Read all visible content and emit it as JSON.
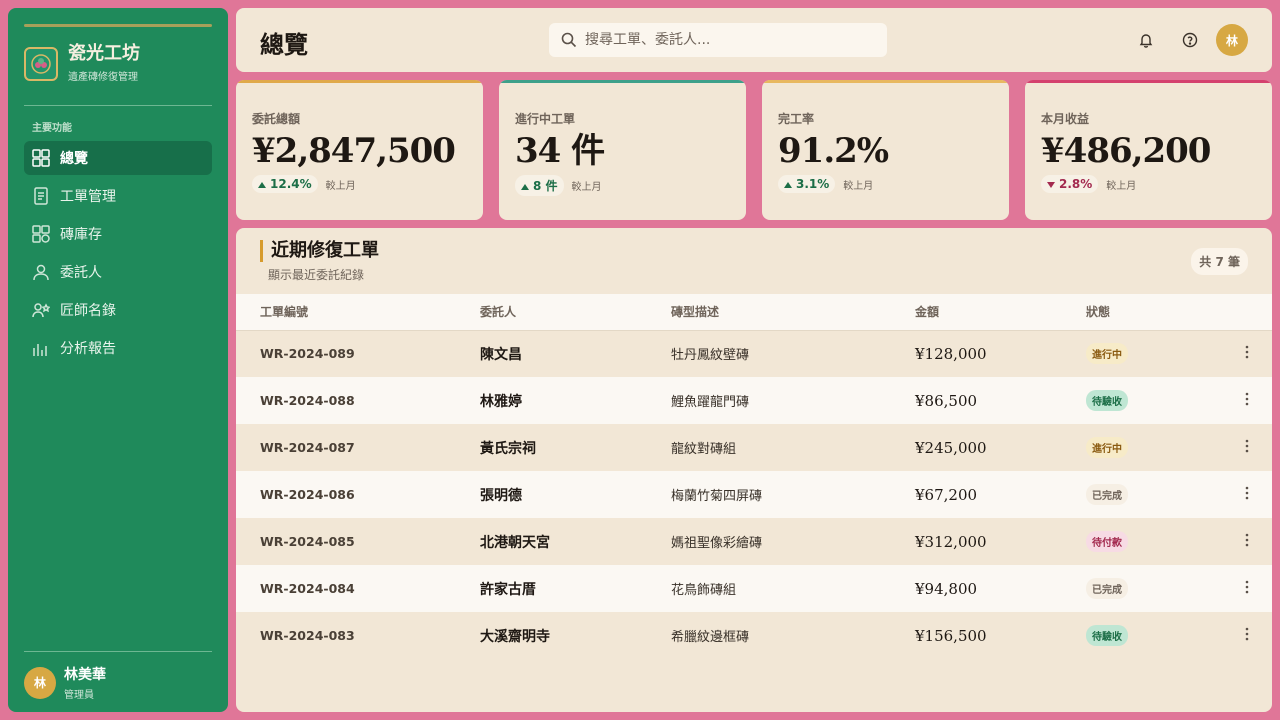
{
  "app": {
    "name": "瓷光工坊",
    "subtitle": "遺產磚修復管理",
    "logo_icon": "tile-flower-icon",
    "accent": "#1f8a5b"
  },
  "sidebar": {
    "section_label": "主要功能",
    "items": [
      {
        "label": "總覽",
        "icon": "grid-icon",
        "active": true
      },
      {
        "label": "工單管理",
        "icon": "document-icon",
        "active": false
      },
      {
        "label": "磚庫存",
        "icon": "tiles-icon",
        "active": false
      },
      {
        "label": "委託人",
        "icon": "user-icon",
        "active": false
      },
      {
        "label": "匠師名錄",
        "icon": "craftsman-icon",
        "active": false
      },
      {
        "label": "分析報告",
        "icon": "bar-chart-icon",
        "active": false
      }
    ],
    "user": {
      "avatar": "林",
      "name": "林美華",
      "role": "管理員"
    }
  },
  "header": {
    "title": "總覽",
    "search_placeholder": "搜尋工單、委託人...",
    "avatar": "林"
  },
  "stats": [
    {
      "label": "委託總額",
      "value": "¥2,847,500",
      "delta": "12.4%",
      "direction": "up",
      "note": "較上月",
      "accent": "#e0a94a"
    },
    {
      "label": "進行中工單",
      "value": "34 件",
      "delta": "8 件",
      "direction": "up",
      "note": "較上月",
      "accent": "#3ea08a"
    },
    {
      "label": "完工率",
      "value": "91.2%",
      "delta": "3.1%",
      "direction": "up",
      "note": "較上月",
      "accent": "#e8b860"
    },
    {
      "label": "本月收益",
      "value": "¥486,200",
      "delta": "2.8%",
      "direction": "down",
      "note": "較上月",
      "accent": "#d4416e"
    }
  ],
  "orders": {
    "title": "近期修復工單",
    "subtitle": "顯示最近委託紀錄",
    "count": "共 7 筆",
    "columns": [
      "工單編號",
      "委託人",
      "磚型描述",
      "金額",
      "狀態"
    ],
    "rows": [
      {
        "id": "WR-2024-089",
        "client": "陳文昌",
        "desc": "牡丹鳳紋壁磚",
        "amount": "¥128,000",
        "status": "進行中"
      },
      {
        "id": "WR-2024-088",
        "client": "林雅婷",
        "desc": "鯉魚躍龍門磚",
        "amount": "¥86,500",
        "status": "待驗收"
      },
      {
        "id": "WR-2024-087",
        "client": "黃氏宗祠",
        "desc": "龍紋對磚組",
        "amount": "¥245,000",
        "status": "進行中"
      },
      {
        "id": "WR-2024-086",
        "client": "張明德",
        "desc": "梅蘭竹菊四屏磚",
        "amount": "¥67,200",
        "status": "已完成"
      },
      {
        "id": "WR-2024-085",
        "client": "北港朝天宮",
        "desc": "媽祖聖像彩繪磚",
        "amount": "¥312,000",
        "status": "待付款"
      },
      {
        "id": "WR-2024-084",
        "client": "許家古厝",
        "desc": "花鳥飾磚組",
        "amount": "¥94,800",
        "status": "已完成"
      },
      {
        "id": "WR-2024-083",
        "client": "大溪齋明寺",
        "desc": "希臘紋邊框磚",
        "amount": "¥156,500",
        "status": "待驗收"
      }
    ]
  },
  "status_colors": {
    "進行中": {
      "bg": "#f7ebc8",
      "fg": "#8a5a10"
    },
    "待驗收": {
      "bg": "#bfe6d3",
      "fg": "#1c6e47"
    },
    "已完成": {
      "bg": "#f6efe4",
      "fg": "#6f645a"
    },
    "待付款": {
      "bg": "#f7dbe4",
      "fg": "#a32a4f"
    }
  }
}
